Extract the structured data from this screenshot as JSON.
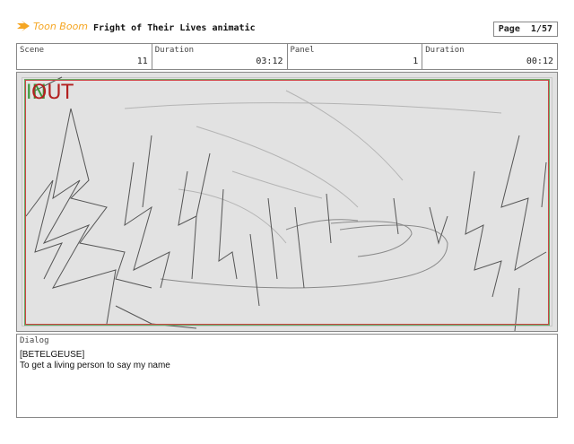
{
  "header": {
    "logo_text": "Toon Boom",
    "project_title": "Fright of Their Lives animatic",
    "page_label": "Page",
    "page_value": "1/57"
  },
  "info": {
    "scene_label": "Scene",
    "scene_value": "11",
    "duration_label": "Duration",
    "duration_value": "03:12",
    "panel_label": "Panel",
    "panel_value": "1",
    "panel_duration_label": "Duration",
    "panel_duration_value": "00:12"
  },
  "panel": {
    "in_marker": "IN",
    "out_marker": "OUT"
  },
  "dialog": {
    "label": "Dialog",
    "line1": "[BETELGEUSE]",
    "line2": "To get a living person to say my name"
  },
  "colors": {
    "logo": "#f5a623",
    "in_marker": "#3c9a3c",
    "out_marker": "#b32020"
  }
}
